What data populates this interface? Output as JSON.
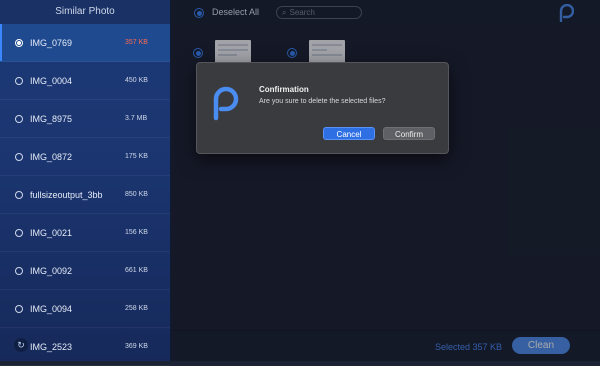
{
  "sidebar": {
    "title": "Similar Photo",
    "items": [
      {
        "name": "IMG_0769",
        "size": "357 KB",
        "selected": true
      },
      {
        "name": "IMG_0004",
        "size": "450 KB"
      },
      {
        "name": "IMG_8975",
        "size": "3.7 MB"
      },
      {
        "name": "IMG_0872",
        "size": "175 KB"
      },
      {
        "name": "fullsizeoutput_3bb",
        "size": "850 KB"
      },
      {
        "name": "IMG_0021",
        "size": "156 KB"
      },
      {
        "name": "IMG_0092",
        "size": "661 KB"
      },
      {
        "name": "IMG_0094",
        "size": "258 KB"
      },
      {
        "name": "IMG_2523",
        "size": "369 KB"
      }
    ]
  },
  "toolbar": {
    "deselect_label": "Deselect All",
    "search_placeholder": "Search"
  },
  "dialog": {
    "title": "Confirmation",
    "message": "Are you sure to delete the selected files?",
    "cancel_label": "Cancel",
    "confirm_label": "Confirm"
  },
  "footer": {
    "selected_text": "Selected 357 KB",
    "clean_label": "Clean"
  },
  "colors": {
    "accent": "#3a86ff",
    "sidebar_bg": "#1d3a77",
    "size_highlight": "#ff6a52"
  }
}
